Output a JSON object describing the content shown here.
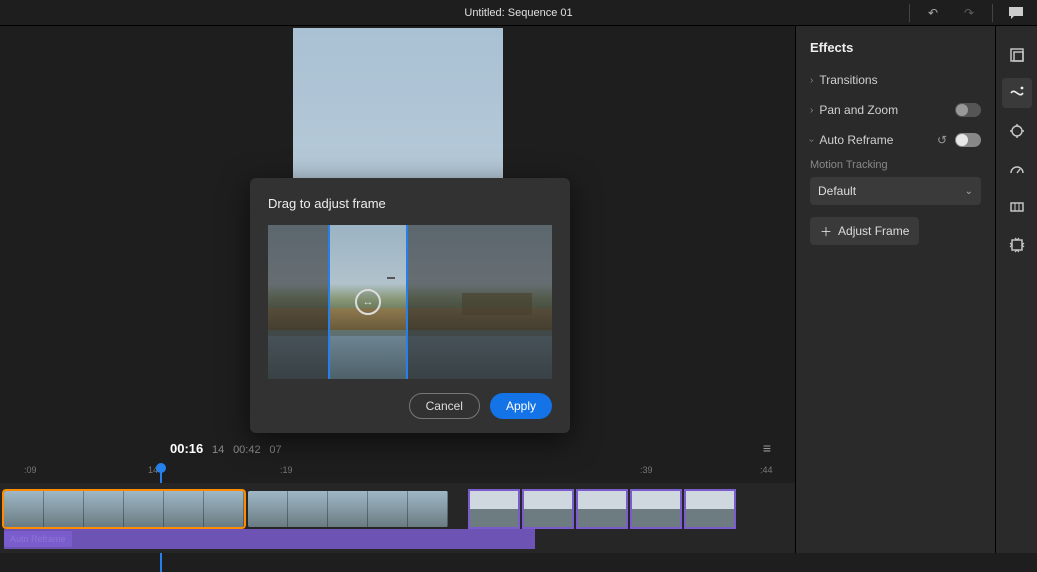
{
  "topbar": {
    "title": "Untitled: Sequence 01",
    "undo_icon": "undo-icon",
    "redo_icon": "redo-icon",
    "chat_icon": "comment-icon"
  },
  "preview": {
    "current_time": "00:16",
    "current_frame": "14",
    "total_time": "00:42",
    "total_frame": "07"
  },
  "ruler": {
    "t0": ":09",
    "t1": "14",
    "t2": ":19",
    "t3": ":39",
    "t4": ":44"
  },
  "timeline": {
    "effect_label": "Auto Reframe"
  },
  "side": {
    "title": "Effects",
    "transitions_label": "Transitions",
    "panzoom_label": "Pan and Zoom",
    "auto_reframe_label": "Auto Reframe",
    "motion_tracking_label": "Motion Tracking",
    "tracking_value": "Default",
    "adjust_frame_label": "Adjust Frame"
  },
  "modal": {
    "title": "Drag to adjust frame",
    "cancel": "Cancel",
    "apply": "Apply"
  }
}
